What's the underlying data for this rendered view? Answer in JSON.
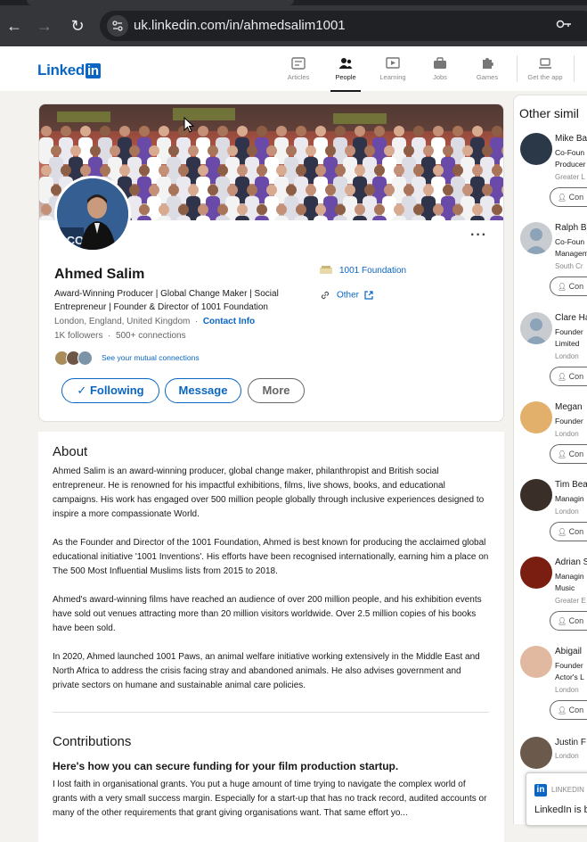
{
  "browser": {
    "url": "uk.linkedin.com/in/ahmedsalim1001",
    "back_icon": "back-arrow-icon",
    "forward_icon": "forward-arrow-icon",
    "reload_icon": "reload-icon",
    "site_info_icon": "tune-icon",
    "password_icon": "key-icon"
  },
  "header": {
    "logo_text": "Linked",
    "logo_in": "in",
    "nav": [
      {
        "label": "Articles",
        "icon": "articles-icon"
      },
      {
        "label": "People",
        "icon": "people-icon"
      },
      {
        "label": "Learning",
        "icon": "learning-icon"
      },
      {
        "label": "Jobs",
        "icon": "briefcase-icon"
      },
      {
        "label": "Games",
        "icon": "puzzle-icon"
      },
      {
        "label": "Get the app",
        "icon": "laptop-icon"
      }
    ],
    "active": "People"
  },
  "profile": {
    "name": "Ahmed Salim",
    "headline": "Award-Winning Producer | Global Change Maker | Social Entrepreneur | Founder & Director of 1001 Foundation",
    "location": "London, England, United Kingdom",
    "separator": "·",
    "contact_info": "Contact Info",
    "followers": "1K followers",
    "connections": "500+ connections",
    "mutual_link": "See your mutual connections",
    "organization": "1001 Foundation",
    "website": "Other",
    "buttons": {
      "following": "Following",
      "message": "Message",
      "more": "More"
    },
    "more_actions": "···"
  },
  "about": {
    "title": "About",
    "paragraphs": [
      "Ahmed Salim is an award-winning producer, global change maker, philanthropist and British social entrepreneur. He is renowned for his impactful exhibitions, films, live shows, books, and educational campaigns. His work has engaged over 500 million people globally through inclusive experiences designed to inspire a more compassionate World.",
      "As the Founder and Director of the 1001 Foundation, Ahmed is best known for producing the acclaimed global educational initiative '1001 Inventions'. His efforts have been recognised internationally, earning him a place on The 500 Most Influential Muslims lists from 2015 to 2018.",
      "Ahmed's award-winning films have reached an audience of over 200 million people, and his exhibition events have sold out venues attracting more than 20 million visitors worldwide. Over 2.5 million copies of his books have been sold.",
      "In 2020, Ahmed launched 1001 Paws, an animal welfare initiative working extensively in the Middle East and North Africa to address the crisis facing stray and abandoned animals. He also advises government and private sectors on humane and sustainable animal care policies."
    ]
  },
  "contributions": {
    "title": "Contributions",
    "question": "Here's how you can secure funding for your film production startup.",
    "excerpt": "I lost faith in organisational grants. You put a huge amount of time trying to navigate the complex world of grants with a very small success margin. Especially for a start-up that has no track record, audited accounts or many of the other requirements that grant giving organisations want. That same effort yo..."
  },
  "sidebar": {
    "title": "Other simil",
    "people": [
      {
        "name": "Mike Ba",
        "lines": [
          "Co-Foun",
          "Producer"
        ],
        "location": "Greater L",
        "button": "Con"
      },
      {
        "name": "Ralph B",
        "lines": [
          "Co-Foun",
          "Managem"
        ],
        "location": "South Cr",
        "button": "Con"
      },
      {
        "name": "Clare Ha",
        "lines": [
          "Founder",
          "Limited"
        ],
        "location": "London",
        "button": "Con"
      },
      {
        "name": "Megan",
        "lines": [
          "Founder"
        ],
        "location": "London",
        "button": "Con"
      },
      {
        "name": "Tim Bea",
        "lines": [
          "Managin"
        ],
        "location": "London",
        "button": "Con"
      },
      {
        "name": "Adrian S",
        "lines": [
          "Managin",
          "Music"
        ],
        "location": "Greater E",
        "button": "Con"
      },
      {
        "name": "Abigail",
        "lines": [
          "Founder",
          "Actor's L"
        ],
        "location": "London",
        "button": "Con"
      },
      {
        "name": "Justin F",
        "lines": [],
        "location": "London",
        "button": ""
      }
    ]
  },
  "toast": {
    "brand": "LINKEDIN",
    "message": "LinkedIn is b"
  },
  "colors": {
    "brand": "#0a66c2",
    "page_bg": "#f4f2ee",
    "chrome_bg": "#35363a"
  }
}
